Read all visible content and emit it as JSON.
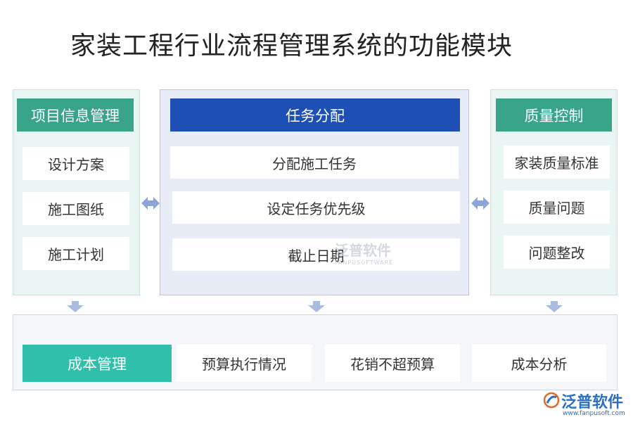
{
  "title": "家装工程行业流程管理系统的功能模块",
  "modules": {
    "project_info": {
      "header": "项目信息管理",
      "items": [
        "设计方案",
        "施工图纸",
        "施工计划"
      ]
    },
    "task_assignment": {
      "header": "任务分配",
      "items": [
        "分配施工任务",
        "设定任务优先级",
        "截止日期"
      ]
    },
    "quality_control": {
      "header": "质量控制",
      "items": [
        "家装质量标准",
        "质量问题",
        "问题整改"
      ]
    },
    "cost_management": {
      "header": "成本管理",
      "items": [
        "预算执行情况",
        "花销不超预算",
        "成本分析"
      ]
    }
  },
  "watermark": {
    "text": "泛普软件",
    "sub": "FANPUSOFTWARE"
  },
  "logo": {
    "text": "泛普软件",
    "url": "www.fanpusoft.com"
  },
  "colors": {
    "green_header": "#3aa48a",
    "blue_header": "#1e4fb4",
    "teal_header": "#2fbfaa",
    "arrow": "#a9bbe0"
  }
}
